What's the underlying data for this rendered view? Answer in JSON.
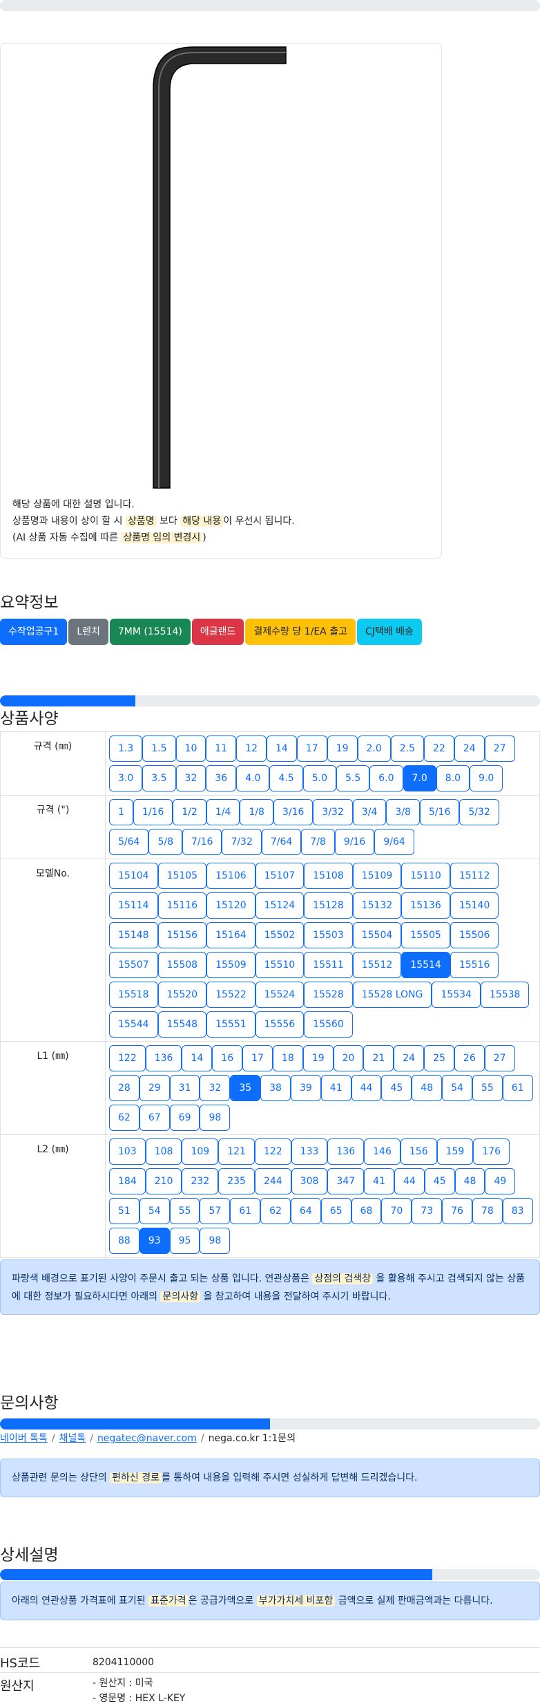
{
  "note": {
    "line1": "해당 상품에 대한 설명 입니다.",
    "line2_a": "상품명과 내용이 상이 할 시",
    "line2_b": "상품명",
    "line2_c": "보다",
    "line2_d": "해당 내용",
    "line2_e": "이 우선시 됩니다.",
    "line3_a": "(AI 상품 자동 수집에 따른",
    "line3_b": "상품명 임의 변경시",
    "line3_c": ")"
  },
  "summary": {
    "title": "요약정보",
    "badges": [
      {
        "label": "수작업공구1",
        "color": "#0d6efd"
      },
      {
        "label": "L렌치",
        "color": "#6c757d"
      },
      {
        "label": "7MM (15514)",
        "color": "#198754"
      },
      {
        "label": "에글랜드",
        "color": "#dc3545"
      },
      {
        "label": "결제수량 당 1/EA 출고",
        "color": "#ffc107",
        "text_color": "#212529"
      },
      {
        "label": "CJ택배 배송",
        "color": "#0dcaf0",
        "text_color": "#212529"
      }
    ]
  },
  "spec": {
    "title": "상품사양",
    "progress": 0.25,
    "rows": [
      {
        "label": "규격 (㎜)",
        "selected": "7.0",
        "options": [
          "1.3",
          "1.5",
          "10",
          "11",
          "12",
          "14",
          "17",
          "19",
          "2.0",
          "2.5",
          "22",
          "24",
          "27",
          "3.0",
          "3.5",
          "32",
          "36",
          "4.0",
          "4.5",
          "5.0",
          "5.5",
          "6.0",
          "7.0",
          "8.0",
          "9.0"
        ]
      },
      {
        "label": "규격 (\")",
        "selected": "",
        "options": [
          "1",
          "1/16",
          "1/2",
          "1/4",
          "1/8",
          "3/16",
          "3/32",
          "3/4",
          "3/8",
          "5/16",
          "5/32",
          "5/64",
          "5/8",
          "7/16",
          "7/32",
          "7/64",
          "7/8",
          "9/16",
          "9/64"
        ]
      },
      {
        "label": "모델No.",
        "selected": "15514",
        "options": [
          "15104",
          "15105",
          "15106",
          "15107",
          "15108",
          "15109",
          "15110",
          "15112",
          "15114",
          "15116",
          "15120",
          "15124",
          "15128",
          "15132",
          "15136",
          "15140",
          "15148",
          "15156",
          "15164",
          "15502",
          "15503",
          "15504",
          "15505",
          "15506",
          "15507",
          "15508",
          "15509",
          "15510",
          "15511",
          "15512",
          "15514",
          "15516",
          "15518",
          "15520",
          "15522",
          "15524",
          "15528",
          "15528 LONG",
          "15534",
          "15538",
          "15544",
          "15548",
          "15551",
          "15556",
          "15560"
        ]
      },
      {
        "label": "L1 (㎜)",
        "selected": "35",
        "options": [
          "122",
          "136",
          "14",
          "16",
          "17",
          "18",
          "19",
          "20",
          "21",
          "24",
          "25",
          "26",
          "27",
          "28",
          "29",
          "31",
          "32",
          "35",
          "38",
          "39",
          "41",
          "44",
          "45",
          "48",
          "54",
          "55",
          "61",
          "62",
          "67",
          "69",
          "98"
        ]
      },
      {
        "label": "L2 (㎜)",
        "selected": "93",
        "options": [
          "103",
          "108",
          "109",
          "121",
          "122",
          "133",
          "136",
          "146",
          "156",
          "159",
          "176",
          "184",
          "210",
          "232",
          "235",
          "244",
          "308",
          "347",
          "41",
          "44",
          "45",
          "48",
          "49",
          "51",
          "54",
          "55",
          "57",
          "61",
          "62",
          "64",
          "65",
          "68",
          "70",
          "73",
          "76",
          "78",
          "83",
          "88",
          "93",
          "95",
          "98"
        ]
      }
    ],
    "alert_a": "파랑색 배경으로 표기된 사양이 주문시 출고 되는 상품 입니다. 연관상품은",
    "alert_b": "상점의 검색창",
    "alert_c": "을 활용해 주시고 검색되지 않는 상품에 대한 정보가 필요하시다면 아래의",
    "alert_d": "문의사항",
    "alert_e": "을 참고하여 내용을 전달하여 주시기 바랍니다."
  },
  "inquiry": {
    "title": "문의사항",
    "progress": 0.5,
    "link1": "네이버 톡톡",
    "link2": "채널톡",
    "link3": "negatec@naver.com",
    "text4": "nega.co.kr 1:1문의",
    "alert_a": "상품관련 문의는 상단의",
    "alert_b": "편하신 경로",
    "alert_c": "를 통하여 내용을 입력해 주시면 성실하게 답변해 드리겠습니다."
  },
  "detail": {
    "title": "상세설명",
    "progress": 0.8,
    "alert_a": "아래의 연관상품 가격표에 표기된",
    "alert_b": "표준가격",
    "alert_c": "은 공급가액으로",
    "alert_d": "부가가치세 비포함",
    "alert_e": "금액으로 실제 판매금액과는 다릅니다.",
    "hs_label": "HS코드",
    "hs_value": "8204110000",
    "origin_label": "원산지",
    "origin_line1": "- 원산지 : 미국",
    "origin_line2": "- 영문명 : HEX L-KEY"
  }
}
